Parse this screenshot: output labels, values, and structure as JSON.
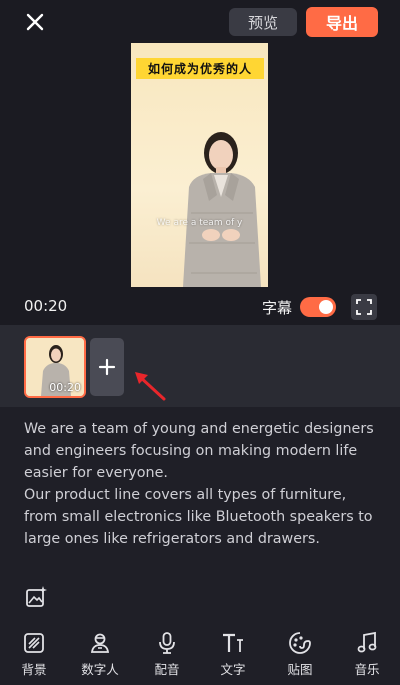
{
  "header": {
    "preview_label": "预览",
    "export_label": "导出"
  },
  "video": {
    "title_text": "如何成为优秀的人",
    "subtitle_overlay": "We are a team of y"
  },
  "controls": {
    "time": "00:20",
    "subtitle_label": "字幕",
    "subtitle_enabled": true
  },
  "timeline": {
    "clips": [
      {
        "duration": "00:20"
      }
    ]
  },
  "script": {
    "paragraphs": [
      "We are a team of young and energetic designers and engineers focusing on making modern life easier for everyone.",
      "Our product line covers all types of furniture, from small electronics like Bluetooth speakers to large ones like refrigerators and drawers."
    ]
  },
  "bottom_nav": {
    "items": [
      {
        "label": "背景",
        "icon": "background-icon"
      },
      {
        "label": "数字人",
        "icon": "digital-human-icon"
      },
      {
        "label": "配音",
        "icon": "microphone-icon"
      },
      {
        "label": "文字",
        "icon": "text-icon"
      },
      {
        "label": "贴图",
        "icon": "sticker-icon"
      },
      {
        "label": "音乐",
        "icon": "music-icon"
      }
    ]
  },
  "colors": {
    "accent": "#ff6b45",
    "background": "#1f1f27"
  }
}
